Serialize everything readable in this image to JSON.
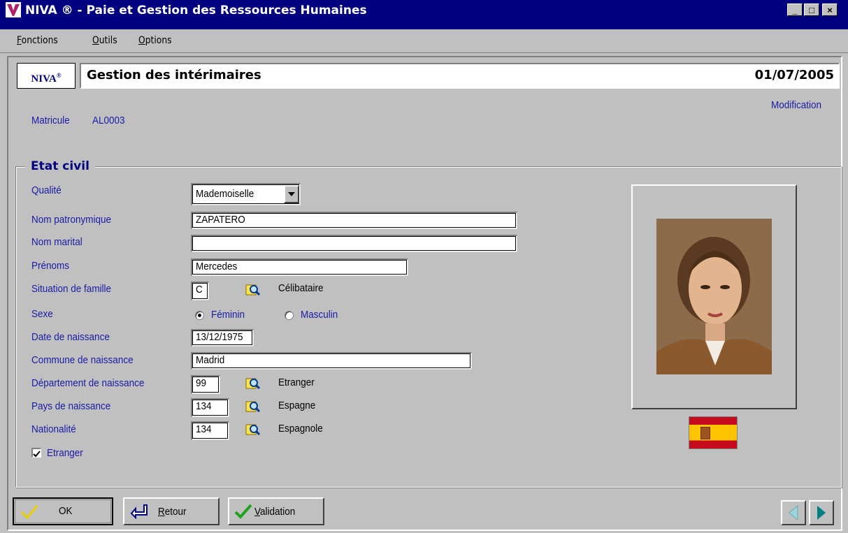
{
  "window": {
    "title": "NIVA ® - Paie et Gestion des Ressources Humaines",
    "minimize": "_",
    "maximize": "□",
    "close": "×"
  },
  "menu": [
    {
      "accel": "F",
      "rest": "onctions"
    },
    {
      "accel": "O",
      "rest": "utils"
    },
    {
      "accel": "O",
      "rest": "ptions"
    }
  ],
  "header": {
    "logo": "NIVA",
    "logo_mark": "®",
    "title": "Gestion des intérimaires",
    "date": "01/07/2005"
  },
  "mode": "Modification",
  "matricule": {
    "label": "Matricule",
    "value": "AL0003"
  },
  "etat_civil": {
    "title": "Etat civil",
    "qualite": {
      "label": "Qualité",
      "value": "Mademoiselle"
    },
    "nom_patronymique": {
      "label": "Nom patronymique",
      "value": "ZAPATERO"
    },
    "nom_marital": {
      "label": "Nom marital",
      "value": ""
    },
    "prenoms": {
      "label": "Prénoms",
      "value": "Mercedes"
    },
    "situation": {
      "label": "Situation de famille",
      "code": "C",
      "text": "Célibataire"
    },
    "sexe": {
      "label": "Sexe",
      "options": [
        "Féminin",
        "Masculin"
      ],
      "selected": "Féminin"
    },
    "date_naissance": {
      "label": "Date de naissance",
      "value": "13/12/1975"
    },
    "commune": {
      "label": "Commune de naissance",
      "value": "Madrid"
    },
    "departement": {
      "label": "Département de naissance",
      "code": "99",
      "text": "Etranger"
    },
    "pays": {
      "label": "Pays de naissance",
      "code": "134",
      "text": "Espagne"
    },
    "nationalite": {
      "label": "Nationalité",
      "code": "134",
      "text": "Espagnole"
    },
    "etranger": {
      "label": "Etranger",
      "checked": true
    }
  },
  "buttons": {
    "ok": {
      "label": "OK"
    },
    "retour": {
      "accel": "R",
      "rest": "etour"
    },
    "validation": {
      "accel": "V",
      "rest": "alidation"
    }
  },
  "colors": {
    "title_bar": "#000080",
    "label_blue": "#1a1aa8",
    "check_green": "#1fa31f",
    "nav_teal": "#008080"
  }
}
